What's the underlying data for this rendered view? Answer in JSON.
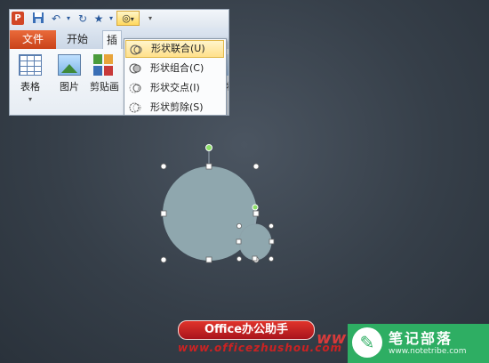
{
  "ribbon": {
    "app_icon": "P",
    "qat": {
      "save_icon": "save-icon",
      "undo_icon": "undo-icon",
      "redo_icon": "redo-icon",
      "star_icon": "star-icon",
      "shape_combine_icon": "shape-combine-icon"
    },
    "tabs": [
      {
        "label": "文件"
      },
      {
        "label": "开始"
      },
      {
        "label": "插"
      }
    ],
    "buttons": [
      {
        "label": "表格"
      },
      {
        "label": "图片"
      },
      {
        "label": "剪贴画"
      }
    ],
    "partial_label": "形状"
  },
  "menu": {
    "items": [
      {
        "label": "形状联合(U)",
        "highlighted": true
      },
      {
        "label": "形状组合(C)"
      },
      {
        "label": "形状交点(I)"
      },
      {
        "label": "形状剪除(S)"
      }
    ]
  },
  "colors": {
    "shape_fill": "#8fa7ae",
    "file_tab": "#d24726",
    "highlight": "#ffe08a",
    "brand_green": "#2eae63"
  },
  "watermark": {
    "badge": "Office办公助手",
    "url": "www.officezhushou.com",
    "www": "www",
    "site_title": "笔记部落",
    "site_url": "www.notetribe.com"
  }
}
